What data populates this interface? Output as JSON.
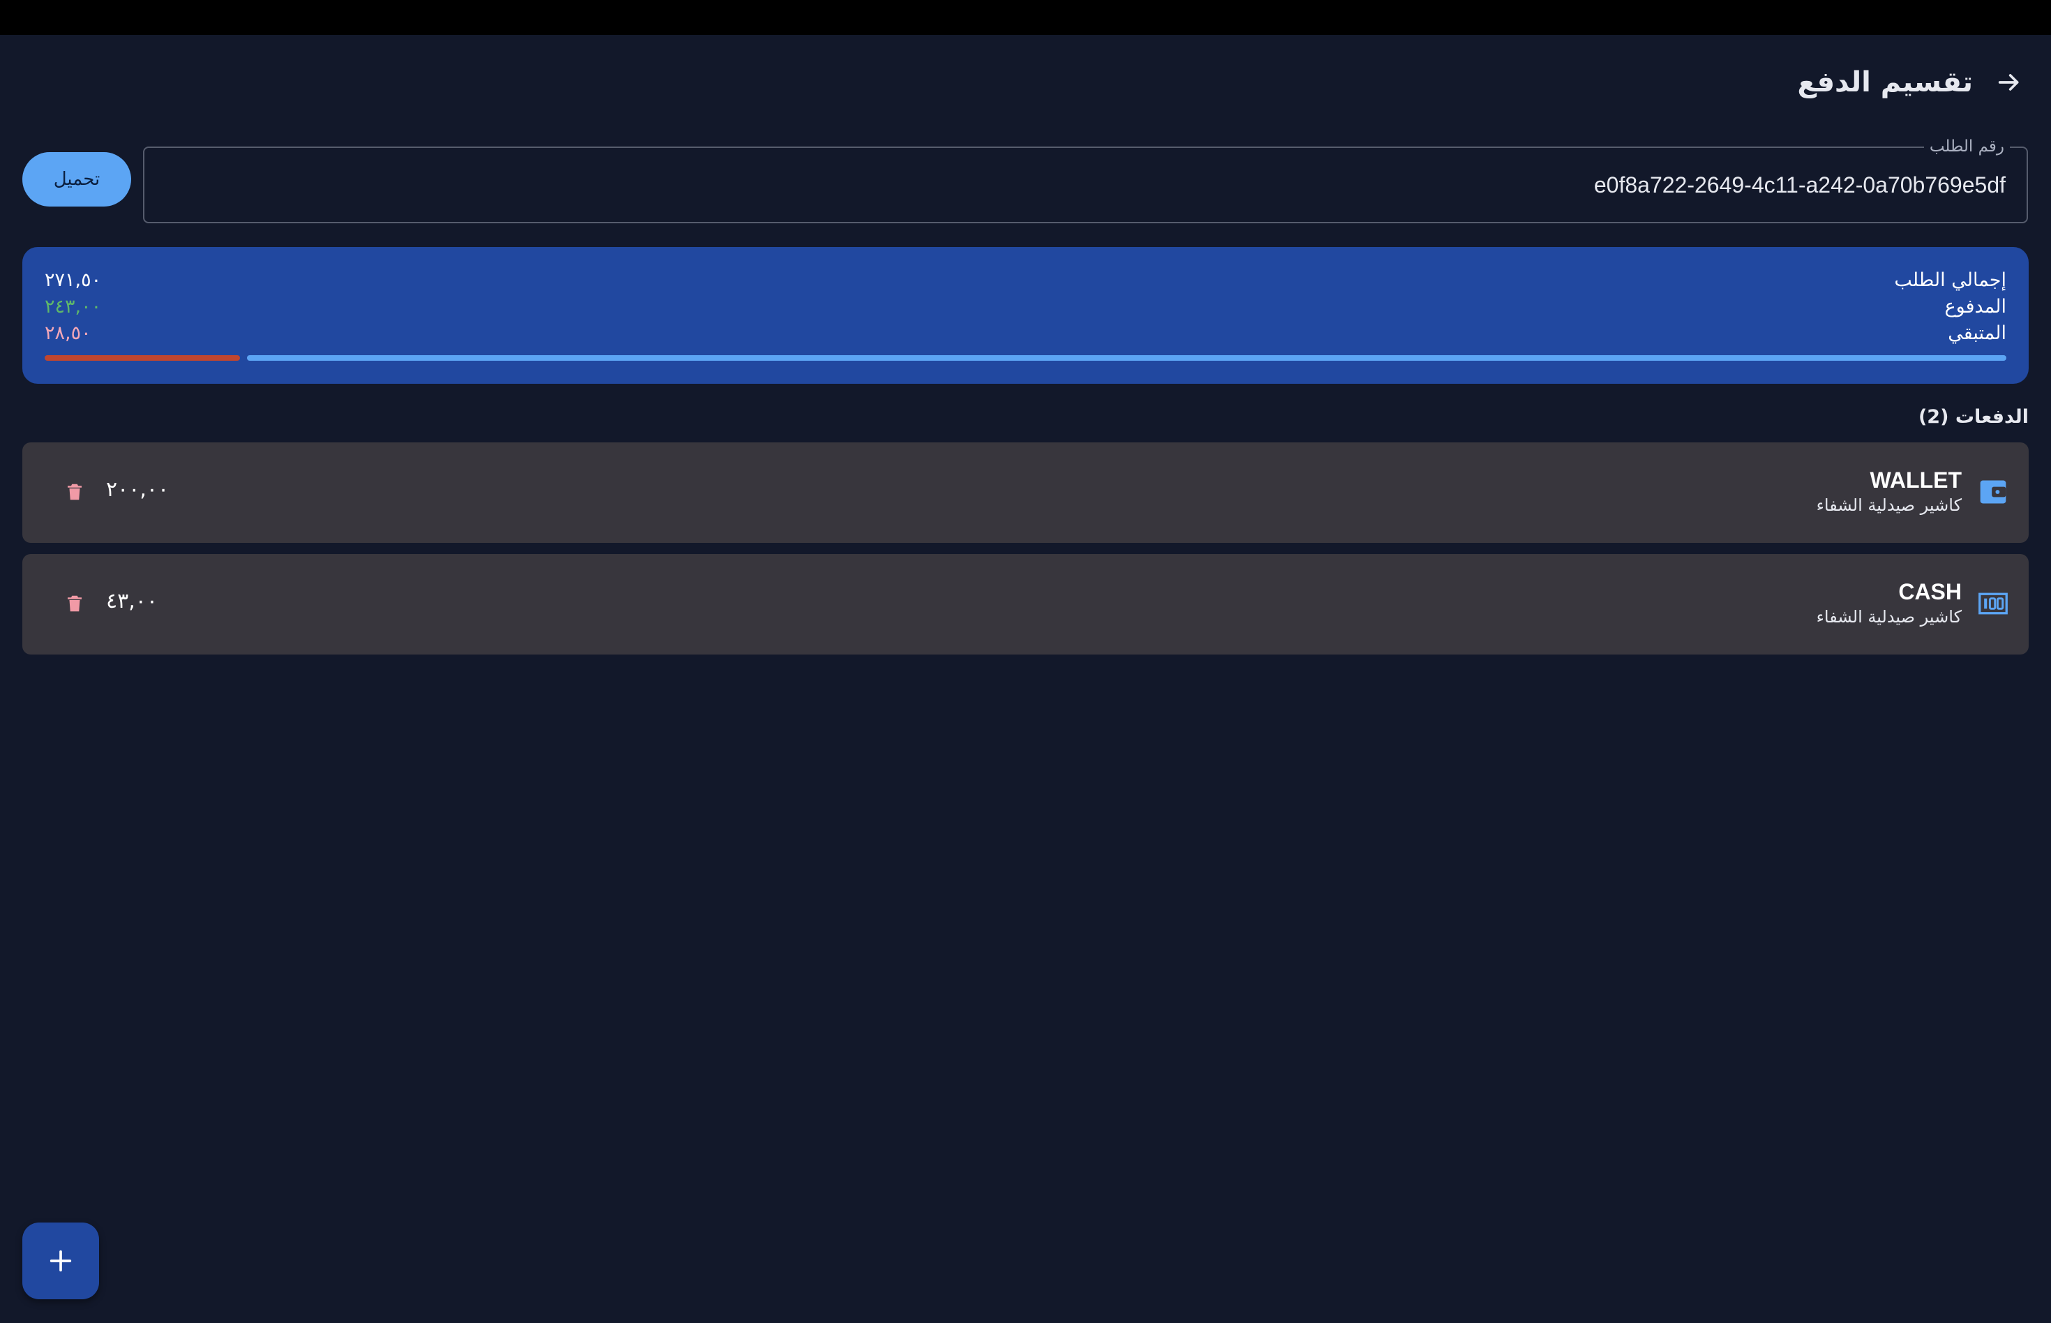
{
  "app": {
    "title": "تقسيم الدفع"
  },
  "order": {
    "field_label": "رقم الطلب",
    "field_value": "e0f8a722-2649-4c11-a242-0a70b769e5df",
    "load_label": "تحميل"
  },
  "summary": {
    "total_label": "إجمالي الطلب",
    "total_value": "٢٧١,٥٠",
    "paid_label": "المدفوع",
    "paid_value": "٢٤٣,٠٠",
    "remaining_label": "المتبقي",
    "remaining_value": "٢٨,٥٠",
    "paid_fraction": 0.8967
  },
  "payments": {
    "header": "الدفعات (2)",
    "items": [
      {
        "method": "WALLET",
        "cashier": "كاشير صيدلية الشفاء",
        "amount": "٢٠٠,٠٠",
        "icon": "wallet-icon"
      },
      {
        "method": "CASH",
        "cashier": "كاشير صيدلية الشفاء",
        "amount": "٤٣,٠٠",
        "icon": "cash-icon"
      }
    ]
  },
  "icons": {
    "back": "arrow-back-icon",
    "delete": "trash-icon",
    "add": "plus-icon"
  },
  "colors": {
    "background": "#12182a",
    "summary_card": "#2148a0",
    "accent": "#5ca5f4",
    "paid": "#5fb86a",
    "remaining": "#f4a8b8",
    "remaining_bar": "#c0462f",
    "delete": "#f19aa6",
    "payment_card": "#38363d"
  }
}
